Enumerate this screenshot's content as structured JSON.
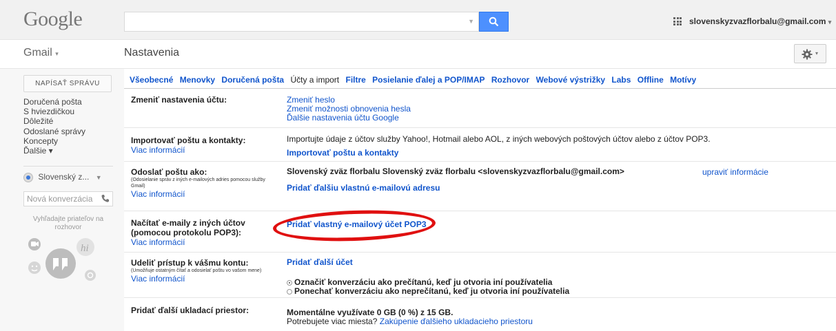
{
  "header": {
    "logo": "Google",
    "account": "slovenskyzvazflorbalu@gmail.com",
    "account_caret": "▾"
  },
  "subbar": {
    "app_label": "Gmail",
    "app_caret": "▾",
    "title": "Nastavenia",
    "settings_caret": "▾"
  },
  "sidebar": {
    "compose": "NAPÍSAŤ SPRÁVU",
    "items": [
      {
        "label": "Doručená pošta"
      },
      {
        "label": "S hviezdičkou"
      },
      {
        "label": "Dôležité"
      },
      {
        "label": "Odoslané správy"
      },
      {
        "label": "Koncepty"
      },
      {
        "label": "Ďalšie ▾"
      }
    ],
    "hangouts_user": "Slovenský z...",
    "new_conversation_placeholder": "Nová konverzácia",
    "hint": "Vyhľadajte priateľov na rozhovor"
  },
  "tabs": [
    {
      "label": "Všeobecné",
      "active": false
    },
    {
      "label": "Menovky",
      "active": false
    },
    {
      "label": "Doručená pošta",
      "active": false
    },
    {
      "label": "Účty a import",
      "active": true
    },
    {
      "label": "Filtre",
      "active": false
    },
    {
      "label": "Posielanie ďalej a POP/IMAP",
      "active": false
    },
    {
      "label": "Rozhovor",
      "active": false
    },
    {
      "label": "Webové výstrižky",
      "active": false
    },
    {
      "label": "Labs",
      "active": false
    },
    {
      "label": "Offline",
      "active": false
    },
    {
      "label": "Motívy",
      "active": false
    }
  ],
  "rows": {
    "change_account": {
      "label": "Zmeniť nastavenia účtu:",
      "links": [
        "Zmeniť heslo",
        "Zmeniť možnosti obnovenia hesla",
        "Ďalšie nastavenia účtu Google"
      ]
    },
    "import": {
      "label": "Importovať poštu a kontakty:",
      "more": "Viac informácií",
      "desc": "Importujte údaje z účtov služby Yahoo!, Hotmail alebo AOL, z iných webových poštových účtov alebo z účtov POP3.",
      "action": "Importovať poštu a kontakty"
    },
    "send_as": {
      "label": "Odoslať poštu ako:",
      "sub": "(Odosielanie správ z iných e-mailových adries pomocou služby Gmail)",
      "more": "Viac informácií",
      "identity": "Slovenský zväz florbalu Slovenský zväz florbalu <slovenskyzvazflorbalu@gmail.com>",
      "edit": "upraviť informácie",
      "action": "Pridať ďalšiu vlastnú e-mailovú adresu"
    },
    "check_mail": {
      "label_line1": "Načítať e-maily z iných účtov",
      "label_line2": "(pomocou protokolu POP3):",
      "more": "Viac informácií",
      "action": "Pridať vlastný e-mailový účet POP3"
    },
    "grant_access": {
      "label": "Udeliť prístup k vášmu kontu:",
      "sub": "(Umožňuje ostatným čítať a odosielať poštu vo vašom mene)",
      "more": "Viac informácií",
      "action": "Pridať ďalší účet",
      "option_read": "Označiť konverzáciu ako prečítanú, keď ju otvoria iní používatelia",
      "option_unread": "Ponechať konverzáciu ako neprečítanú, keď ju otvoria iní používatelia"
    },
    "storage": {
      "label": "Pridať ďalší ukladací priestor:",
      "usage": "Momentálne využívate 0 GB (0 %) z 15 GB.",
      "question": "Potrebujete viac miesta?",
      "purchase": "Zakúpenie ďalšieho ukladacieho priestoru"
    }
  },
  "colors": {
    "link": "#1155cc",
    "search_button": "#4d90fe",
    "annotation": "#e01010"
  }
}
